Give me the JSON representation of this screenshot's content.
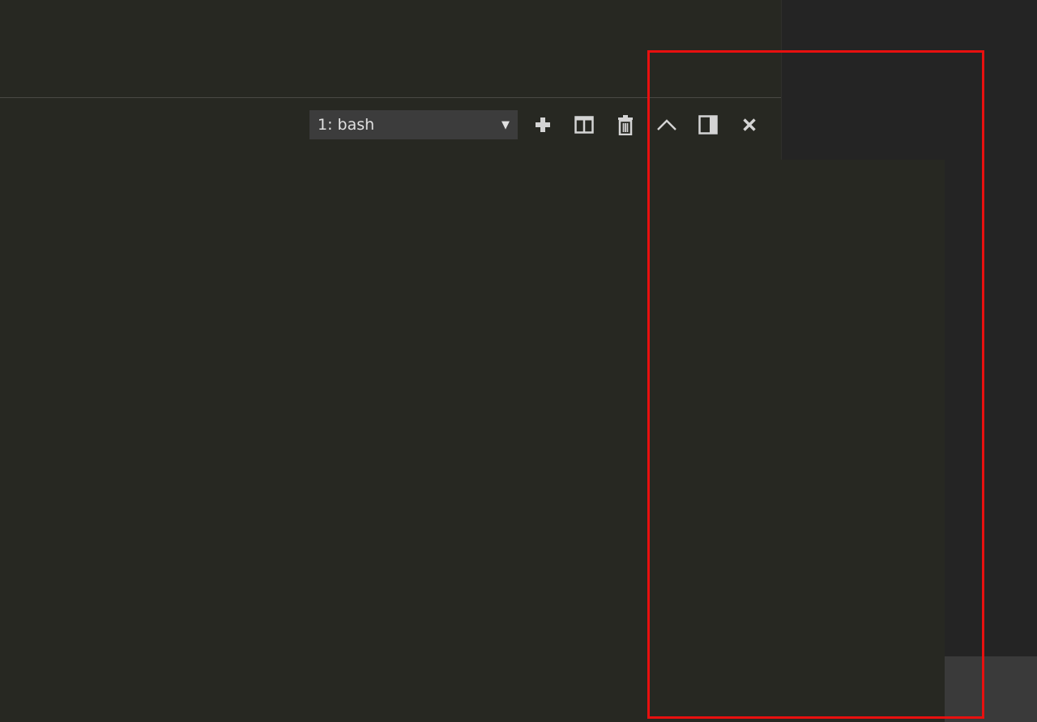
{
  "panel": {
    "terminal_selector": {
      "selected": "1: bash",
      "arrow": "▼"
    },
    "actions": [
      {
        "name": "new-terminal",
        "icon": "plus-icon"
      },
      {
        "name": "split-terminal",
        "icon": "split-icon"
      },
      {
        "name": "kill-terminal",
        "icon": "trash-icon"
      },
      {
        "name": "maximize-panel",
        "icon": "chevron-up-icon"
      },
      {
        "name": "toggle-panel-position",
        "icon": "panel-right-icon"
      },
      {
        "name": "close-panel",
        "icon": "close-icon"
      }
    ]
  },
  "colors": {
    "background": "#272822",
    "side_background": "#242424",
    "select_background": "#3c3c3c",
    "icon": "#d4d4d4",
    "highlight": "#e8100f"
  }
}
